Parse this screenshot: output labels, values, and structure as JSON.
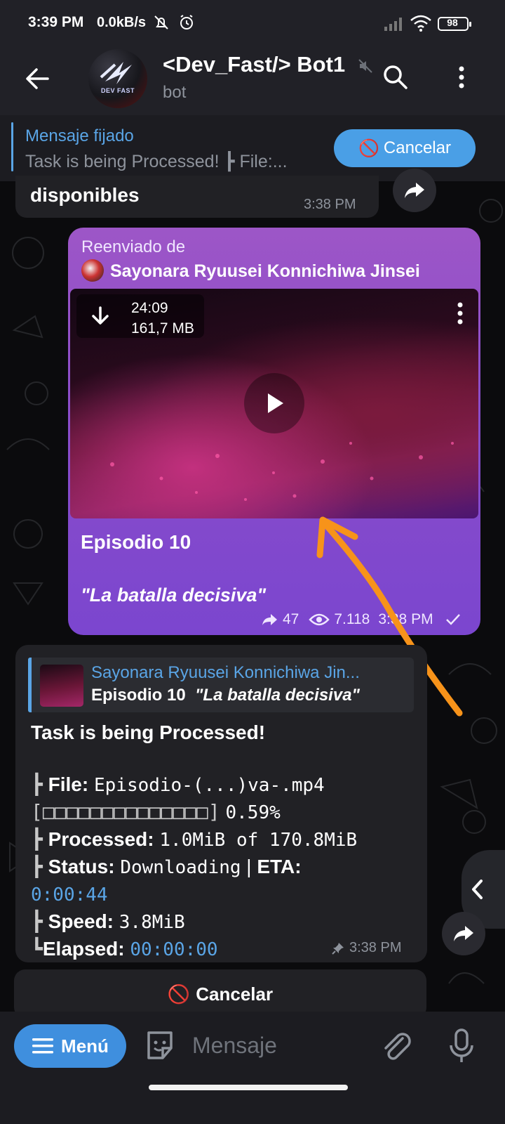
{
  "status_bar": {
    "time": "3:39 PM",
    "net_speed": "0.0kB/s",
    "battery": "98",
    "icons": [
      "mute-bell-icon",
      "alarm-icon",
      "signal-icon",
      "wifi-icon",
      "battery-icon"
    ]
  },
  "header": {
    "title": "<Dev_Fast/> Bot1",
    "subtitle": "bot",
    "avatar_text": "DEV FAST",
    "icons": [
      "back-arrow-icon",
      "muted-speaker-icon",
      "search-icon",
      "more-vertical-icon"
    ]
  },
  "pinned": {
    "label": "Mensaje fijado",
    "text": "Task is being Processed!  ┣ File:...",
    "cancel_label": "Cancelar",
    "cancel_icon": "🚫"
  },
  "previous_message": {
    "text": "disponibles",
    "time": "3:38 PM"
  },
  "forwarded_message": {
    "label": "Reenviado de",
    "channel": "Sayonara Ryuusei Konnichiwa Jinsei",
    "video": {
      "duration": "24:09",
      "size": "161,7 MB"
    },
    "title": "Episodio 10",
    "subtitle": "\"La batalla decisiva\"",
    "shares": "47",
    "views": "7.118",
    "time": "3:38 PM",
    "colors": {
      "bubble": "#8c4dc9"
    }
  },
  "task_message": {
    "reply_name": "Sayonara Ryuusei Konnichiwa Jin...",
    "reply_text_a": "Episodio 10",
    "reply_text_b": "\"La batalla decisiva\"",
    "heading": "Task is being Processed!",
    "file_label": "File:",
    "file_value": "Episodio-(...)va-.mp4",
    "progress_bar": "[□□□□□□□□□□□□□□]",
    "progress_value": "0.59%",
    "progress_fraction": 0.0059,
    "processed_label": "Processed:",
    "processed_value": "1.0MiB of 170.8MiB",
    "status_label": "Status:",
    "status_value": "Downloading",
    "eta_label": "ETA:",
    "eta_value": "0:00:44",
    "speed_label": "Speed:",
    "speed_value": "3.8MiB",
    "elapsed_label": "Elapsed:",
    "elapsed_value": "00:00:00",
    "time": "3:38 PM"
  },
  "inline_button": {
    "label": "Cancelar",
    "icon": "🚫"
  },
  "input_bar": {
    "menu_label": "Menú",
    "placeholder": "Mensaje",
    "icons": [
      "menu-lines-icon",
      "sticker-icon",
      "attach-icon",
      "mic-icon"
    ]
  },
  "accent_color": "#5aa5e6"
}
